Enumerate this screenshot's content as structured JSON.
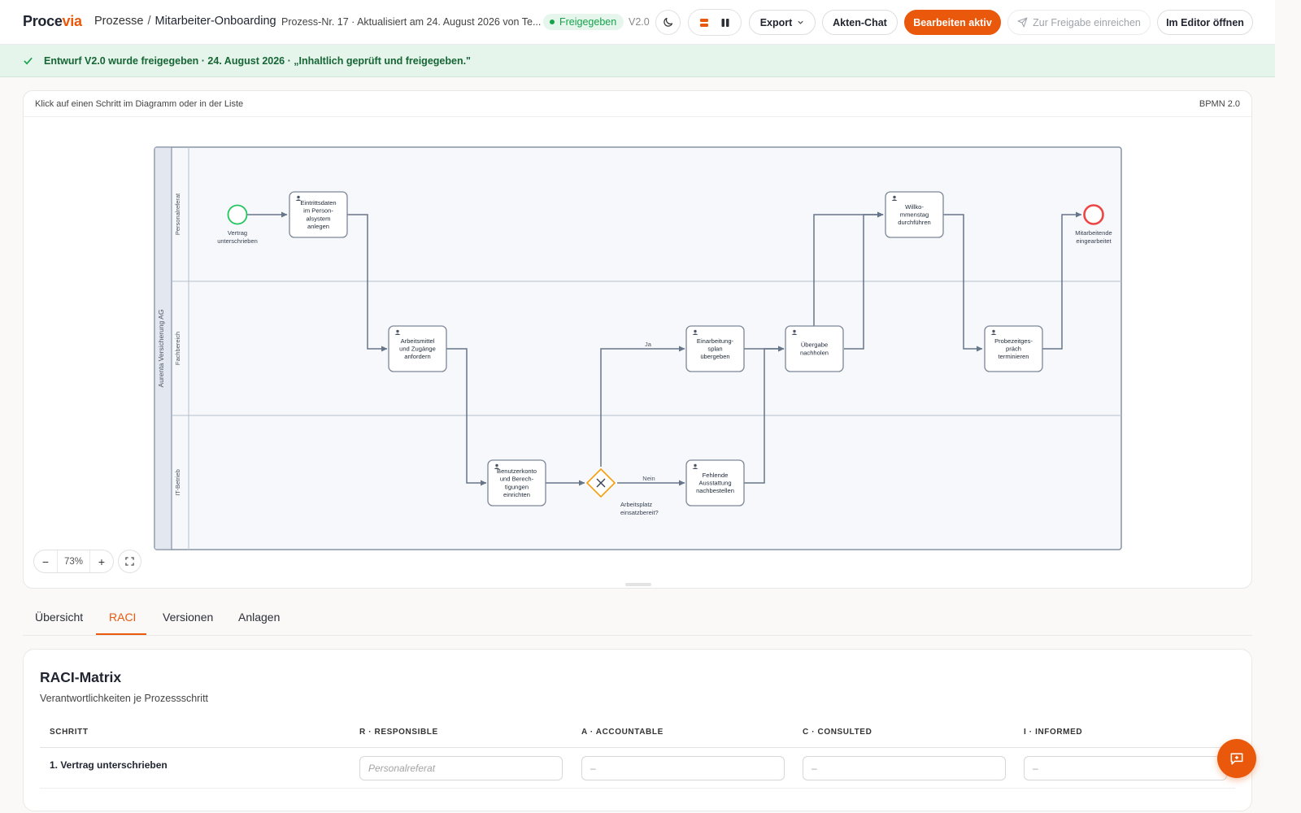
{
  "app": {
    "logo_part1": "Proce",
    "logo_part2": "via"
  },
  "breadcrumb": {
    "parent": "Prozesse",
    "separator": "/",
    "current": "Mitarbeiter-Onboarding"
  },
  "process_meta": "Prozess-Nr. 17 · Aktualisiert am 24. August 2026 von Te...",
  "status_badge": "Freigegeben",
  "version": "V2.0",
  "toolbar": {
    "export_label": "Export",
    "chat_label": "Akten-Chat",
    "edit_label": "Bearbeiten aktiv",
    "submit_label": "Zur Freigabe einreichen",
    "editor_label": "Im Editor öffnen"
  },
  "banner": "Entwurf V2.0 wurde freigegeben · 24. August 2026 · „Inhaltlich geprüft und freigegeben.\"",
  "diagram": {
    "hint": "Klick auf einen Schritt im Diagramm oder in der Liste",
    "standard": "BPMN 2.0",
    "pool": "Aurenta Versicherung AG",
    "lanes": [
      "Personalreferat",
      "Fachbereich",
      "IT-Betrieb"
    ],
    "start_event": [
      "Vertrag",
      "unterschrieben"
    ],
    "end_event": [
      "Mitarbeitende",
      "eingearbeitet"
    ],
    "gateway": [
      "Arbeitsplatz",
      "einsatzbereit?"
    ],
    "flow_yes": "Ja",
    "flow_no": "Nein",
    "tasks": [
      {
        "id": "t1",
        "lines": [
          "Eintrittsdaten",
          "im Person-",
          "alsystem",
          "anlegen"
        ]
      },
      {
        "id": "t2",
        "lines": [
          "Arbeitsmittel",
          "und Zugänge",
          "anfordern"
        ]
      },
      {
        "id": "t3",
        "lines": [
          "Benutzerkonto",
          "und Berech-",
          "tigungen",
          "einrichten"
        ]
      },
      {
        "id": "t4",
        "lines": [
          "Einarbeitung-",
          "splan",
          "übergeben"
        ]
      },
      {
        "id": "t5",
        "lines": [
          "Fehlende",
          "Ausstattung",
          "nachbestellen"
        ]
      },
      {
        "id": "t6",
        "lines": [
          "Übergabe",
          "nachholen"
        ]
      },
      {
        "id": "t7",
        "lines": [
          "Willko-",
          "mmenstag",
          "durchführen"
        ]
      },
      {
        "id": "t8",
        "lines": [
          "Probezeitges-",
          "präch",
          "terminieren"
        ]
      }
    ]
  },
  "zoom": {
    "minus": "−",
    "value": "73%",
    "plus": "+"
  },
  "tabs": [
    "Übersicht",
    "RACI",
    "Versionen",
    "Anlagen"
  ],
  "raci": {
    "title": "RACI-Matrix",
    "subtitle": "Verantwortlichkeiten je Prozessschritt",
    "columns": [
      "SCHRITT",
      "R · RESPONSIBLE",
      "A · ACCOUNTABLE",
      "C · CONSULTED",
      "I · INFORMED"
    ],
    "rows": [
      {
        "step": "1. Vertrag unterschrieben",
        "r_placeholder": "Personalreferat",
        "a_placeholder": "–",
        "c_placeholder": "–",
        "i_placeholder": "–"
      }
    ]
  },
  "colors": {
    "accent": "#ea580c",
    "success": "#16a34a",
    "start_event": "#22c55e",
    "end_event": "#ef4444",
    "gateway": "#f59e0b"
  }
}
